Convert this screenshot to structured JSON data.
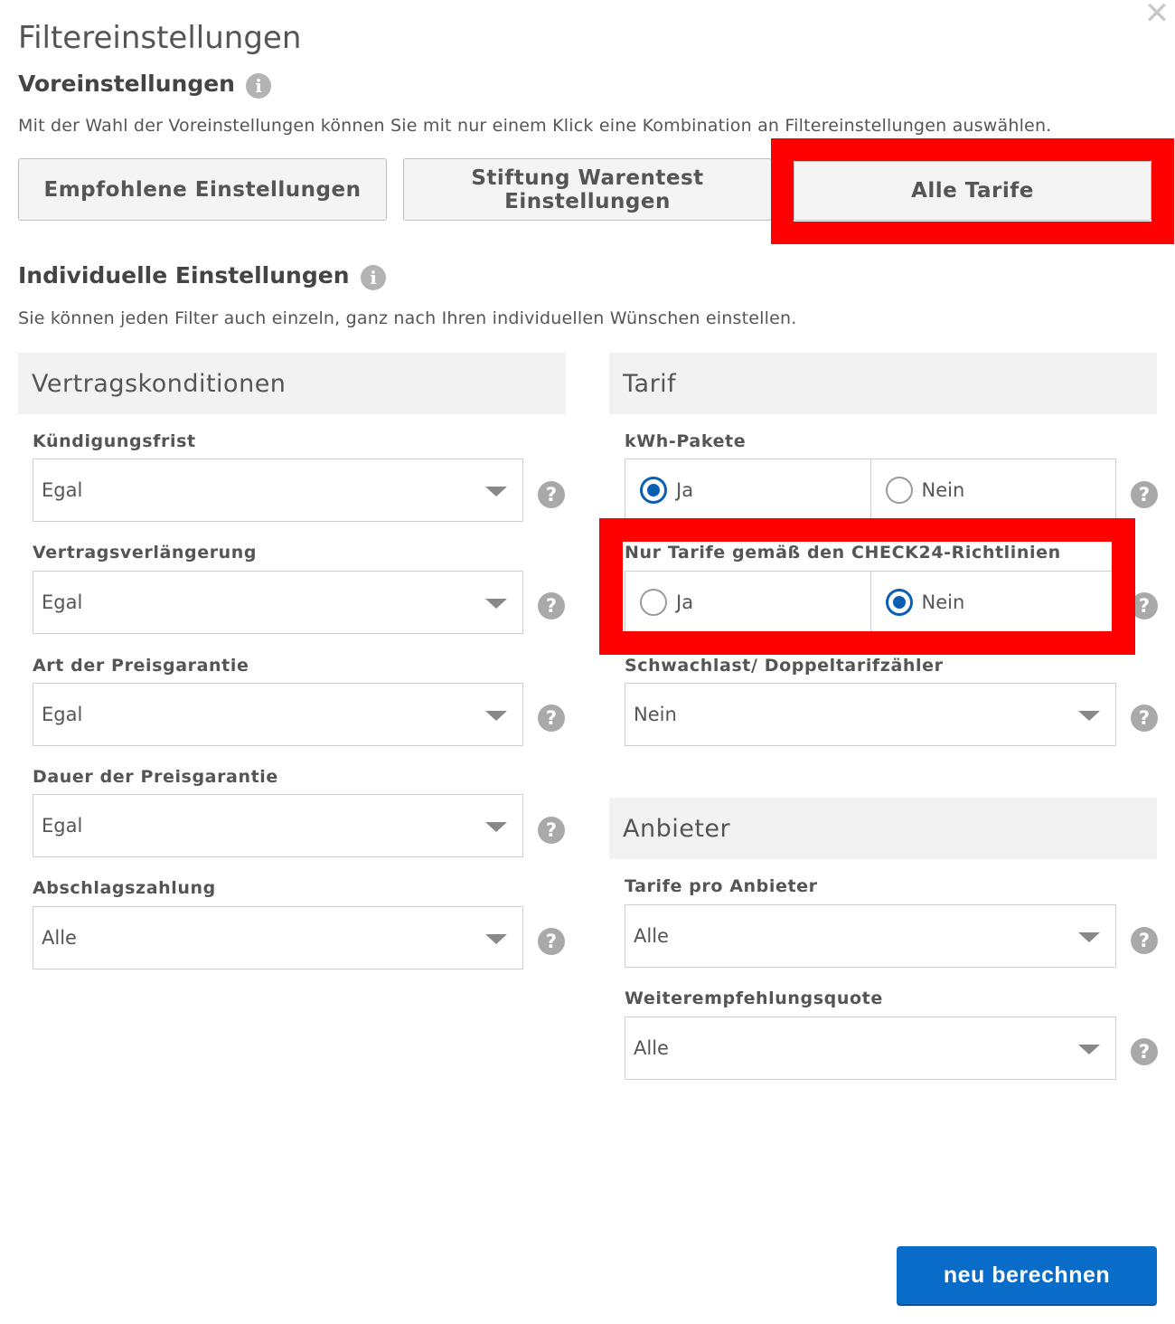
{
  "dialog": {
    "title": "Filtereinstellungen",
    "close_icon": "close-icon"
  },
  "presets": {
    "heading": "Voreinstellungen",
    "info_icon": "i",
    "description": "Mit der Wahl der Voreinstellungen können Sie mit nur einem Klick eine Kombination an Filtereinstellungen auswählen.",
    "buttons": [
      {
        "label": "Empfohlene Einstellungen"
      },
      {
        "label": "Stiftung Warentest\nEinstellungen"
      },
      {
        "label": "Alle Tarife"
      }
    ]
  },
  "individual": {
    "heading": "Individuelle Einstellungen",
    "info_icon": "i",
    "description": "Sie können jeden Filter auch einzeln, ganz nach Ihren individuellen Wünschen einstellen."
  },
  "vertrag": {
    "header": "Vertragskonditionen",
    "fields": [
      {
        "label": "Kündigungsfrist",
        "value": "Egal"
      },
      {
        "label": "Vertragsverlängerung",
        "value": "Egal"
      },
      {
        "label": "Art der Preisgarantie",
        "value": "Egal"
      },
      {
        "label": "Dauer der Preisgarantie",
        "value": "Egal"
      },
      {
        "label": "Abschlagszahlung",
        "value": "Alle"
      }
    ]
  },
  "tarif": {
    "header": "Tarif",
    "kwh": {
      "label": "kWh-Pakete",
      "options": [
        "Ja",
        "Nein"
      ],
      "selected": "Ja"
    },
    "check24": {
      "label": "Nur Tarife gemäß den CHECK24-Richtlinien",
      "options": [
        "Ja",
        "Nein"
      ],
      "selected": "Nein"
    },
    "schwachlast": {
      "label": "Schwachlast/ Doppeltarifzähler",
      "value": "Nein"
    }
  },
  "anbieter": {
    "header": "Anbieter",
    "fields": [
      {
        "label": "Tarife pro Anbieter",
        "value": "Alle"
      },
      {
        "label": "Weiterempfehlungsquote",
        "value": "Alle"
      }
    ]
  },
  "help_icon": "?",
  "submit": {
    "label": "neu berechnen"
  },
  "colors": {
    "accent": "#0a6cc9",
    "highlight": "#ff0000",
    "radio_checked": "#0a5fb4"
  }
}
